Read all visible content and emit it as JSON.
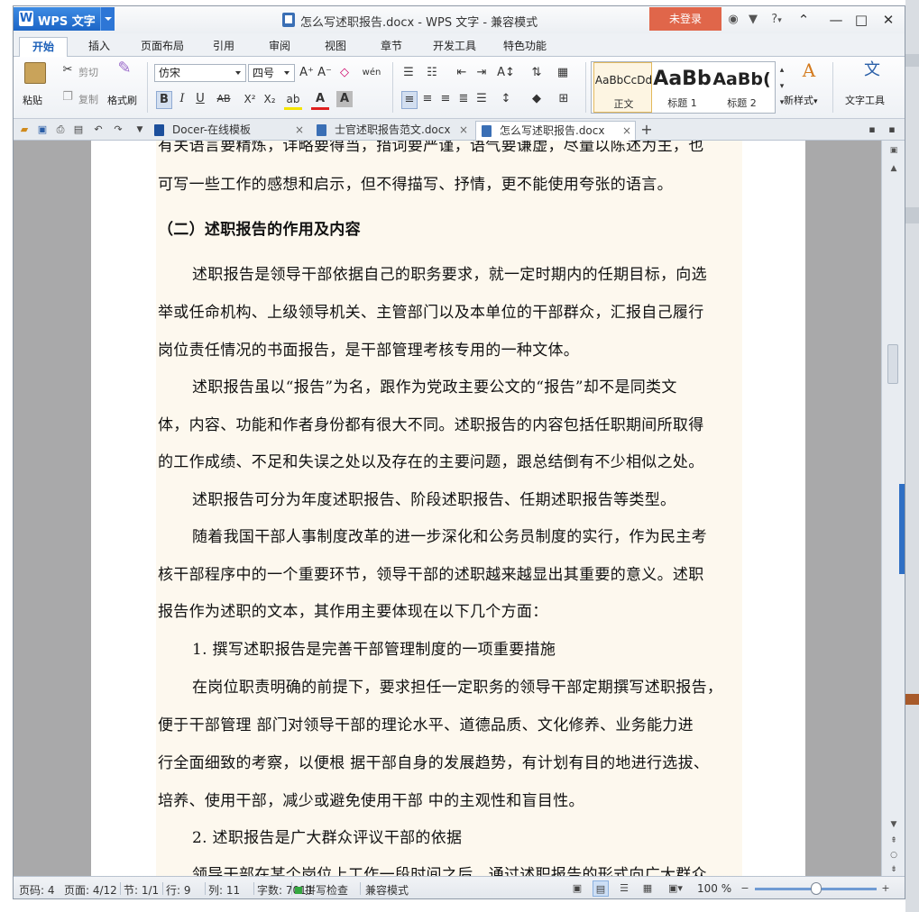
{
  "app": {
    "name": "WPS 文字",
    "logo_letter": "W"
  },
  "title": {
    "text": "怎么写述职报告.docx - WPS 文字 - 兼容模式"
  },
  "login_button": "未登录",
  "title_icons": {
    "skin": "skin-icon",
    "shirt": "shirt-icon",
    "help": "?",
    "help_arrow": "▾"
  },
  "window_controls": {
    "restore": "⌃",
    "minimize": "—",
    "maximize": "□",
    "close": "✕"
  },
  "ribbon_tabs": [
    "开始",
    "插入",
    "页面布局",
    "引用",
    "审阅",
    "视图",
    "章节",
    "开发工具",
    "特色功能"
  ],
  "ribbon": {
    "paste": "粘贴",
    "cut": "剪切",
    "copy": "复制",
    "format_painter": "格式刷",
    "font_name": "仿宋",
    "font_size": "四号",
    "grow_font": "A⁺",
    "shrink_font": "A⁻",
    "clear_format": "◇",
    "phonetic": "wén",
    "bold": "B",
    "italic": "I",
    "underline": "U",
    "strike": "AB",
    "superscript": "X²",
    "subscript": "X₂",
    "highlight": "ab",
    "font_color": "A",
    "char_shade": "A",
    "styles": [
      {
        "preview": "AaBbCcDd",
        "name": "正文"
      },
      {
        "preview": "AaBb",
        "name": "标题 1"
      },
      {
        "preview": "AaBb(",
        "name": "标题 2"
      }
    ],
    "new_style": "新样式",
    "new_style_arrow": "▾",
    "text_tools": "文字工具",
    "text_tools_glyph": "文"
  },
  "doc_tabs": [
    {
      "label": "Docer-在线模板",
      "active": false
    },
    {
      "label": "士官述职报告范文.docx",
      "active": false
    },
    {
      "label": "怎么写述职报告.docx",
      "active": true
    }
  ],
  "doc_tab_close": "×",
  "new_tab": "+",
  "document": {
    "lines": [
      "有关语言要精炼，详略要得当，措词要严谨，语气要谦虚，尽量以陈述为主，也",
      "可写一些工作的感想和启示，但不得描写、抒情，更不能使用夸张的语言。",
      "（二）述职报告的作用及内容",
      "述职报告是领导干部依据自己的职务要求，就一定时期内的任期目标，向选",
      "举或任命机构、上级领导机关、主管部门以及本单位的干部群众，汇报自己履行",
      "岗位责任情况的书面报告，是干部管理考核专用的一种文体。",
      "述职报告虽以“报告”为名，跟作为党政主要公文的“报告”却不是同类文",
      "体，内容、功能和作者身份都有很大不同。述职报告的内容包括任职期间所取得",
      "的工作成绩、不足和失误之处以及存在的主要问题，跟总结倒有不少相似之处。",
      "述职报告可分为年度述职报告、阶段述职报告、任期述职报告等类型。",
      "随着我国干部人事制度改革的进一步深化和公务员制度的实行，作为民主考",
      "核干部程序中的一个重要环节，领导干部的述职越来越显出其重要的意义。述职",
      "报告作为述职的文本，其作用主要体现在以下几个方面：",
      "1. 撰写述职报告是完善干部管理制度的一项重要措施",
      "在岗位职责明确的前提下，要求担任一定职务的领导干部定期撰写述职报告，",
      "便于干部管理 部门对领导干部的理论水平、道德品质、文化修养、业务能力进",
      "行全面细致的考察，以便根 据干部自身的发展趋势，有计划有目的地进行选拔、",
      "培养、使用干部，减少或避免使用干部 中的主观性和盲目性。",
      "2. 述职报告是广大群众评议干部的依据",
      "领导干部在某个岗位上工作一段时间之后，通过述职报告的形式向广大群众"
    ]
  },
  "status_bar": {
    "page_code": "页码: 4",
    "pages": "页面: 4/12",
    "section": "节: 1/1",
    "row": "行: 9",
    "column": "列: 11",
    "word_count": "字数: 7011",
    "spell_check": "拼写检查",
    "mode": "兼容模式",
    "zoom": "100 %",
    "zoom_level_percent": 100
  },
  "colors": {
    "app_blue": "#1c65c6",
    "login_orange": "#e0664a",
    "page_highlight": "#fdf8ee",
    "spell_ok": "#35a840"
  }
}
